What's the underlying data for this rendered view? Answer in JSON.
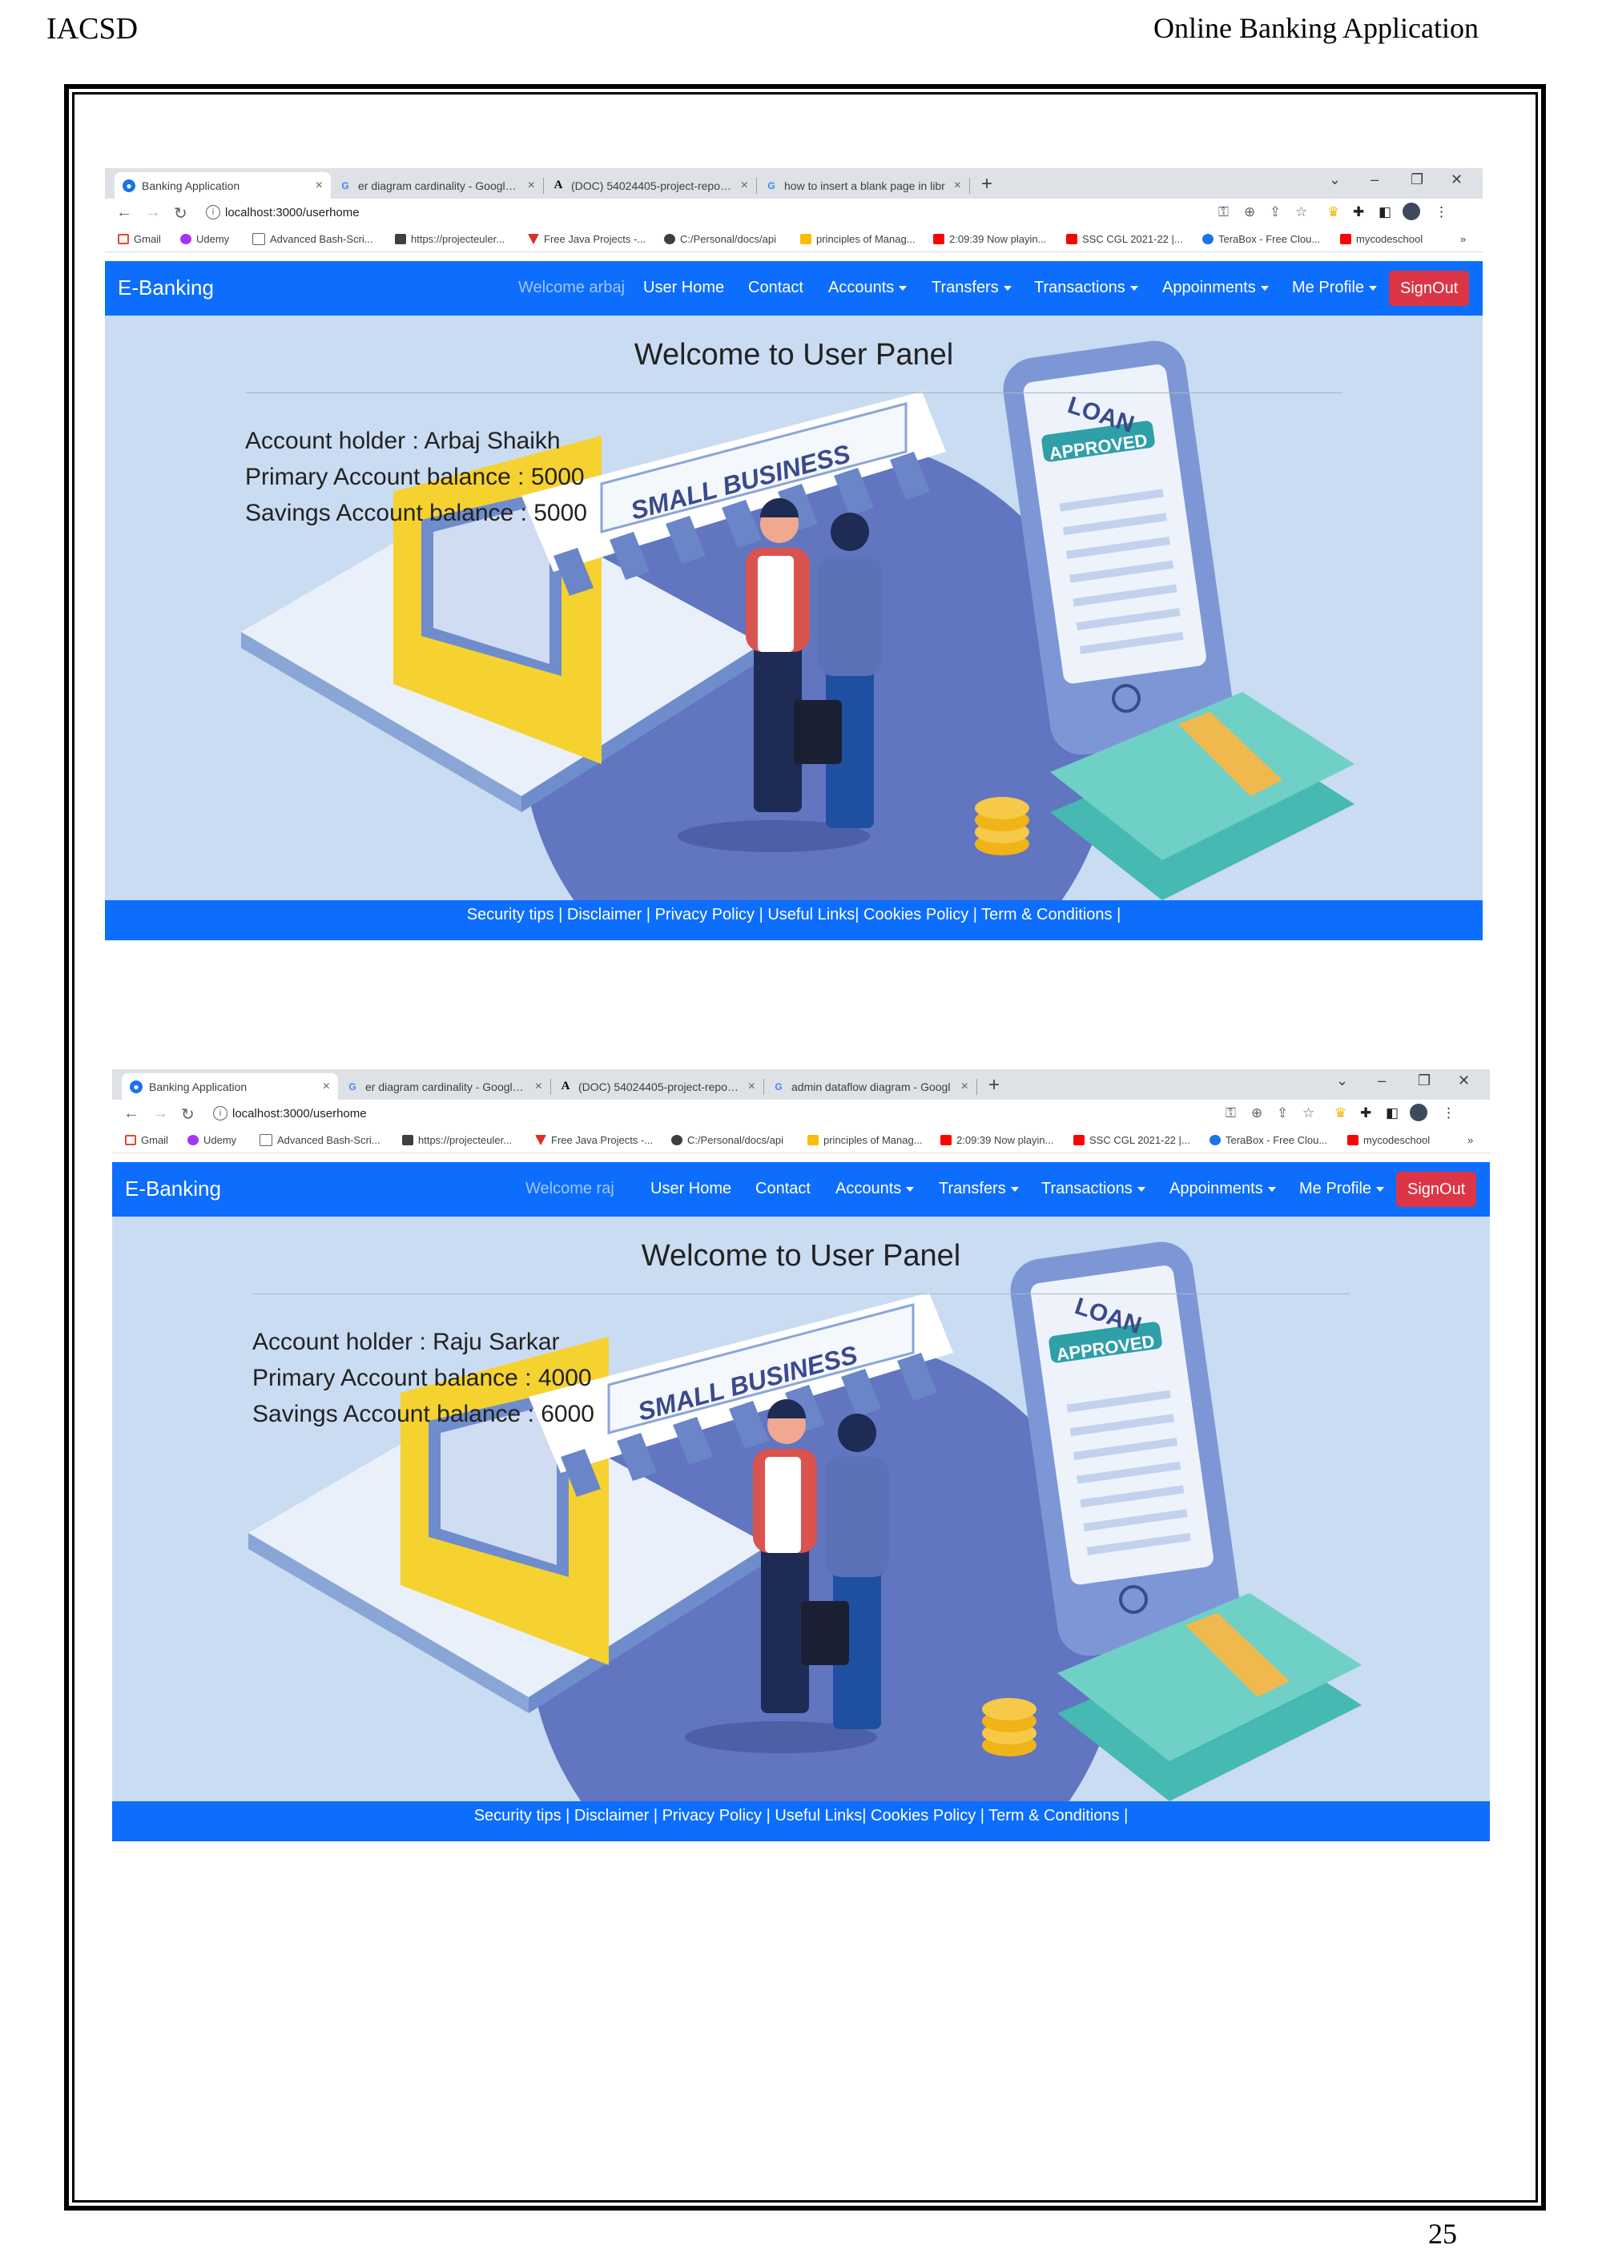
{
  "page": {
    "header_left": "IACSD",
    "header_right": "Online Banking Application",
    "page_number": "25"
  },
  "screens": [
    {
      "tabs": [
        {
          "title": "Banking Application",
          "close": "×"
        },
        {
          "title": "er diagram cardinality - Google S",
          "close": "×"
        },
        {
          "title": "(DOC) 54024405-project-report-c",
          "close": "×"
        },
        {
          "title": "how to insert a blank page in libr",
          "close": "×"
        }
      ],
      "new_tab": "+",
      "window_controls": [
        "⌄",
        "–",
        "❐",
        "✕"
      ],
      "url": "localhost:3000/userhome",
      "bookmarks": [
        "Gmail",
        "Udemy",
        "Advanced Bash-Scri...",
        "https://projecteuler...",
        "Free Java Projects -...",
        "C:/Personal/docs/api",
        "principles of Manag...",
        "2:09:39 Now playin...",
        "SSC CGL 2021-22 |...",
        "TeraBox - Free Clou...",
        "mycodeschool",
        "»"
      ],
      "navbar": {
        "brand": "E-Banking",
        "welcome": "Welcome arbaj",
        "links": [
          "User Home",
          "Contact",
          "Accounts",
          "Transfers",
          "Transactions",
          "Appoinments",
          "Me Profile"
        ],
        "signout": "SignOut"
      },
      "hero": {
        "title": "Welcome to User Panel",
        "account_holder": "Account holder : Arbaj Shaikh",
        "primary_balance": "Primary Account balance : 5000",
        "savings_balance": "Savings Account balance : 5000",
        "shop_sign": "SMALL BUSINESS",
        "phone_label": "LOAN",
        "approved_badge": "APPROVED"
      },
      "footer": "Security tips | Disclaimer | Privacy Policy | Useful Links| Cookies Policy | Term & Conditions |"
    },
    {
      "tabs": [
        {
          "title": "Banking Application",
          "close": "×"
        },
        {
          "title": "er diagram cardinality - Google S",
          "close": "×"
        },
        {
          "title": "(DOC) 54024405-project-report-c",
          "close": "×"
        },
        {
          "title": "admin dataflow diagram - Googl",
          "close": "×"
        }
      ],
      "new_tab": "+",
      "window_controls": [
        "⌄",
        "–",
        "❐",
        "✕"
      ],
      "url": "localhost:3000/userhome",
      "bookmarks": [
        "Gmail",
        "Udemy",
        "Advanced Bash-Scri...",
        "https://projecteuler...",
        "Free Java Projects -...",
        "C:/Personal/docs/api",
        "principles of Manag...",
        "2:09:39 Now playin...",
        "SSC CGL 2021-22 |...",
        "TeraBox - Free Clou...",
        "mycodeschool",
        "»"
      ],
      "navbar": {
        "brand": "E-Banking",
        "welcome": "Welcome raj",
        "links": [
          "User Home",
          "Contact",
          "Accounts",
          "Transfers",
          "Transactions",
          "Appoinments",
          "Me Profile"
        ],
        "signout": "SignOut"
      },
      "hero": {
        "title": "Welcome to User Panel",
        "account_holder": "Account holder : Raju Sarkar",
        "primary_balance": "Primary Account balance : 4000",
        "savings_balance": "Savings Account balance : 6000",
        "shop_sign": "SMALL BUSINESS",
        "phone_label": "LOAN",
        "approved_badge": "APPROVED"
      },
      "footer": "Security tips | Disclaimer | Privacy Policy | Useful Links| Cookies Policy | Term & Conditions |"
    }
  ],
  "colors": {
    "navbar": "#0d6efd",
    "signout": "#dc3545",
    "hero_bg": "#c9dcf2"
  }
}
